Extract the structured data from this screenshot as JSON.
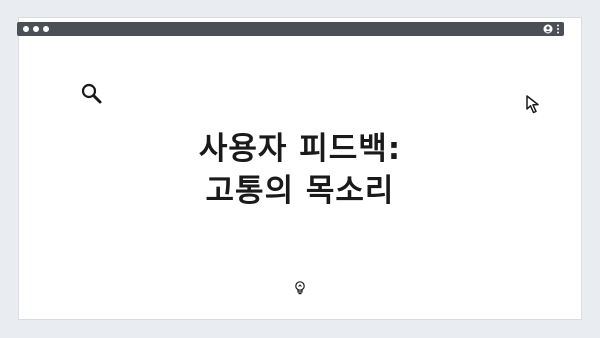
{
  "window": {
    "title_line1": "사용자 피드백:",
    "title_line2": "고통의 목소리"
  },
  "icons": {
    "search": "search-icon",
    "cursor": "cursor-icon",
    "bulb": "lightbulb-icon",
    "profile": "profile-icon",
    "menu": "kebab-menu-icon"
  },
  "colors": {
    "background": "#e9edf1",
    "window": "#ffffff",
    "titlebar": "#4b5057",
    "text": "#1a1a1a"
  }
}
